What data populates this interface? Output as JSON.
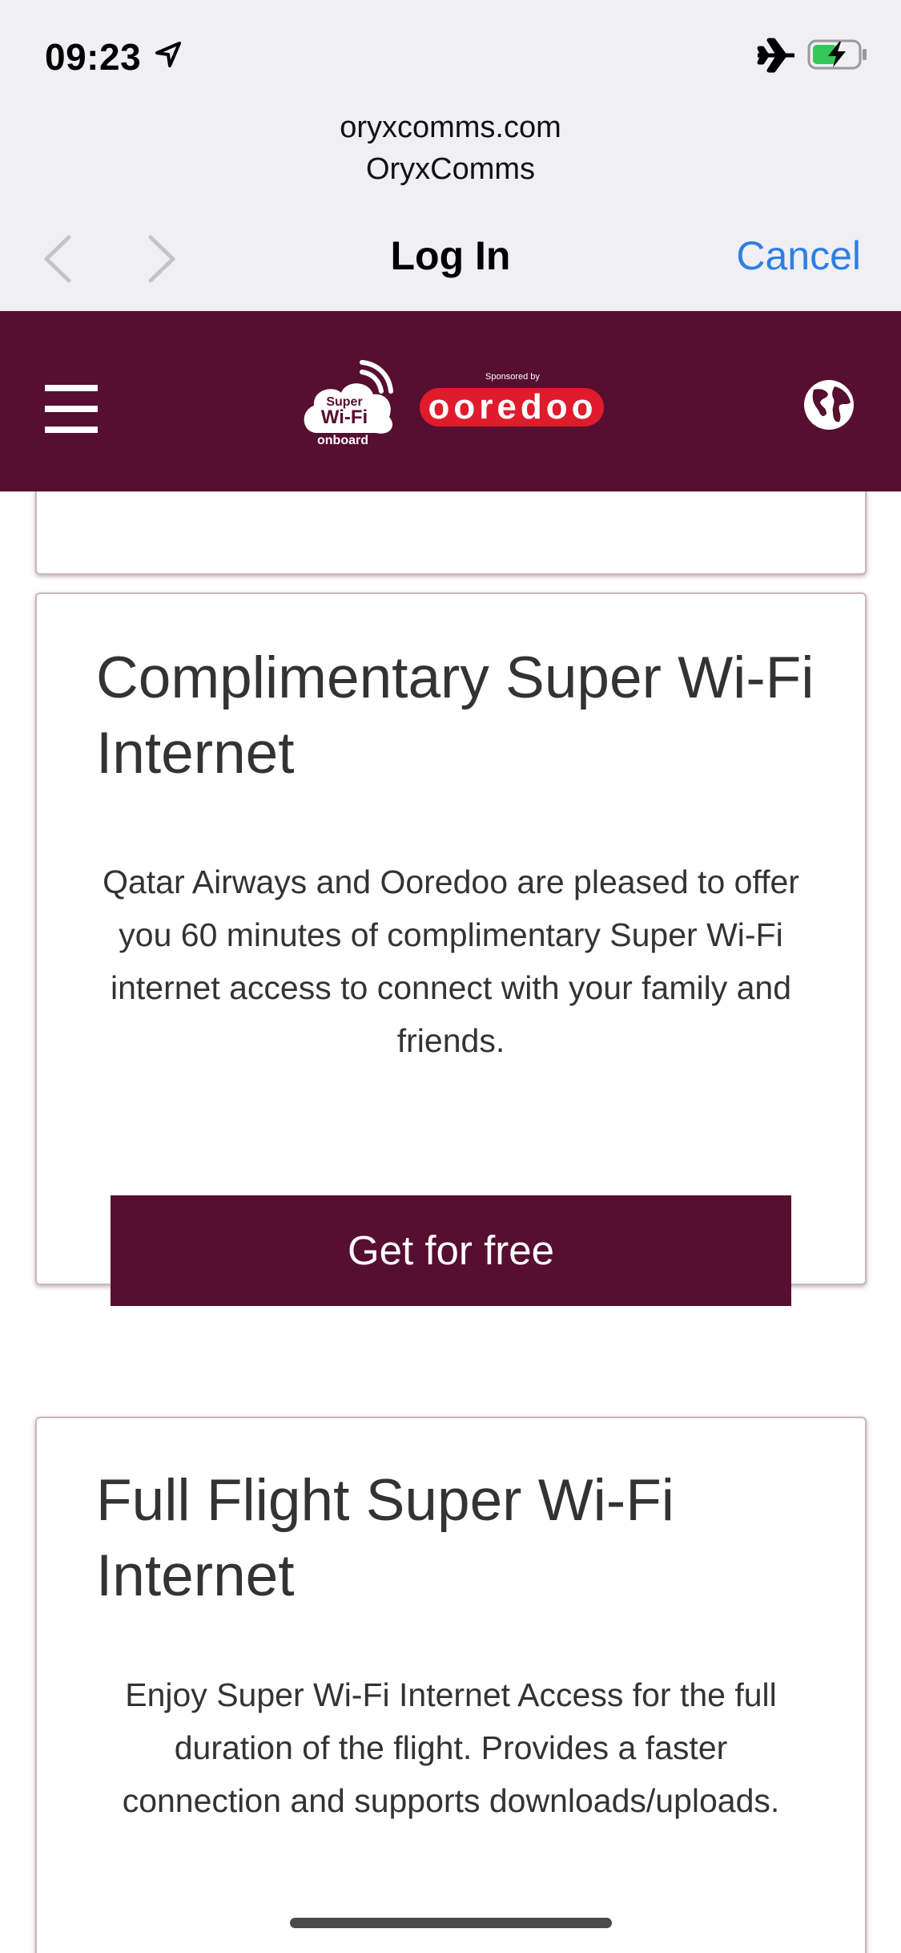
{
  "status_bar": {
    "time": "09:23"
  },
  "browser": {
    "domain": "oryxcomms.com",
    "site_name": "OryxComms",
    "title": "Log In",
    "cancel_label": "Cancel"
  },
  "site_header": {
    "logo_line1": "Super",
    "logo_line2": "Wi-Fi",
    "logo_line3": "onboard",
    "sponsored_text": "Sponsored by",
    "sponsor_name": "ooredoo",
    "brand_color": "#560f30",
    "sponsor_color": "#e01b2b"
  },
  "cards": [
    {
      "title": "Complimentary Super Wi-Fi Internet",
      "description": "Qatar Airways and Ooredoo are pleased to offer you 60 minutes of complimentary Super Wi-Fi internet access to connect with your family and friends.",
      "button_label": "Get for free"
    },
    {
      "title": "Full Flight Super Wi-Fi Internet",
      "description": "Enjoy Super Wi-Fi Internet Access for the full duration of the flight. Provides a faster connection and supports downloads/uploads."
    }
  ],
  "accent_color": "#2f7fe2"
}
